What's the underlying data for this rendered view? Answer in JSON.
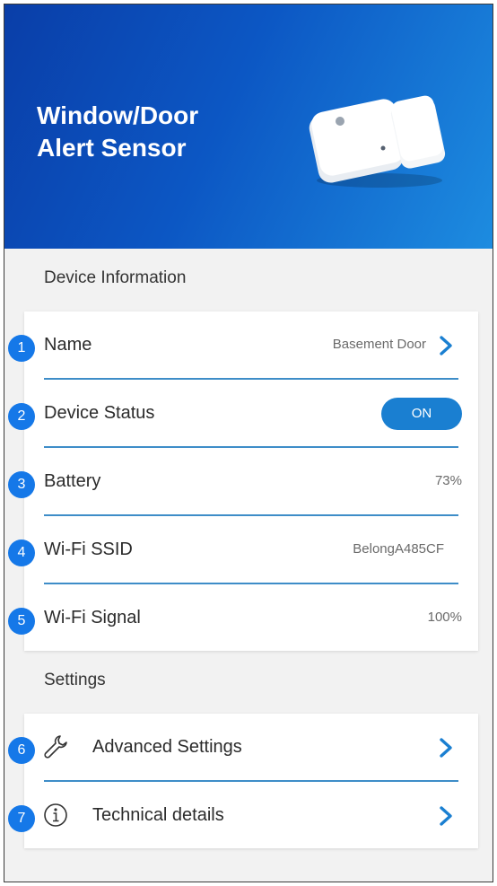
{
  "header": {
    "title": "Window/Door Alert Sensor"
  },
  "device_info": {
    "section_label": "Device Information",
    "rows": [
      {
        "label": "Name",
        "value": "Basement Door"
      },
      {
        "label": "Device Status",
        "toggle": "ON"
      },
      {
        "label": "Battery",
        "value": "73%"
      },
      {
        "label": "Wi-Fi SSID",
        "value": "BelongA485CF"
      },
      {
        "label": "Wi-Fi Signal",
        "value": "100%"
      }
    ]
  },
  "settings": {
    "section_label": "Settings",
    "rows": [
      {
        "label": "Advanced Settings",
        "icon": "wrench-icon"
      },
      {
        "label": "Technical details",
        "icon": "info-icon"
      }
    ]
  },
  "badges": [
    "1",
    "2",
    "3",
    "4",
    "5",
    "6",
    "7"
  ],
  "colors": {
    "header_gradient_start": "#0a3ea8",
    "header_gradient_end": "#1d8ce0",
    "accent": "#1a7fd1",
    "separator": "#3e8dc8",
    "badge": "#1578e8"
  }
}
